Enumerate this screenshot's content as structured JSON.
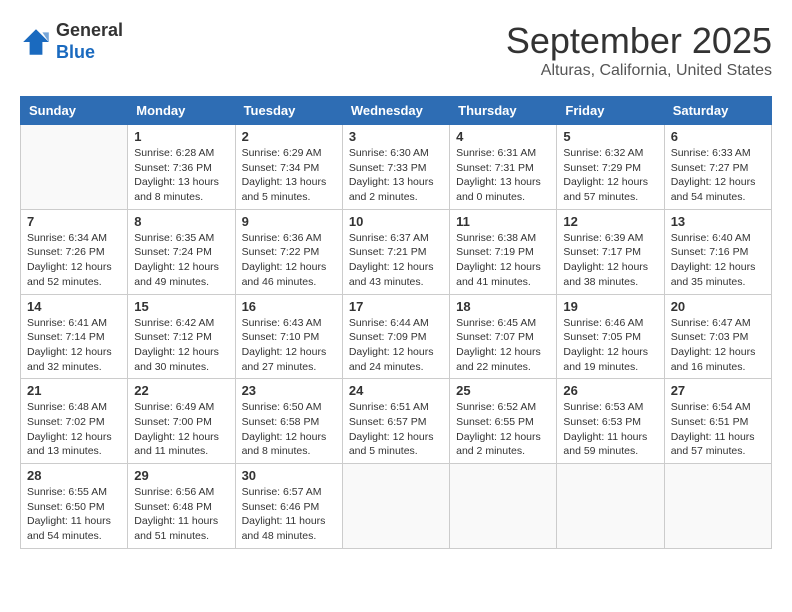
{
  "header": {
    "logo_line1": "General",
    "logo_line2": "Blue",
    "month": "September 2025",
    "location": "Alturas, California, United States"
  },
  "weekdays": [
    "Sunday",
    "Monday",
    "Tuesday",
    "Wednesday",
    "Thursday",
    "Friday",
    "Saturday"
  ],
  "weeks": [
    [
      {
        "day": "",
        "info": ""
      },
      {
        "day": "1",
        "info": "Sunrise: 6:28 AM\nSunset: 7:36 PM\nDaylight: 13 hours\nand 8 minutes."
      },
      {
        "day": "2",
        "info": "Sunrise: 6:29 AM\nSunset: 7:34 PM\nDaylight: 13 hours\nand 5 minutes."
      },
      {
        "day": "3",
        "info": "Sunrise: 6:30 AM\nSunset: 7:33 PM\nDaylight: 13 hours\nand 2 minutes."
      },
      {
        "day": "4",
        "info": "Sunrise: 6:31 AM\nSunset: 7:31 PM\nDaylight: 13 hours\nand 0 minutes."
      },
      {
        "day": "5",
        "info": "Sunrise: 6:32 AM\nSunset: 7:29 PM\nDaylight: 12 hours\nand 57 minutes."
      },
      {
        "day": "6",
        "info": "Sunrise: 6:33 AM\nSunset: 7:27 PM\nDaylight: 12 hours\nand 54 minutes."
      }
    ],
    [
      {
        "day": "7",
        "info": "Sunrise: 6:34 AM\nSunset: 7:26 PM\nDaylight: 12 hours\nand 52 minutes."
      },
      {
        "day": "8",
        "info": "Sunrise: 6:35 AM\nSunset: 7:24 PM\nDaylight: 12 hours\nand 49 minutes."
      },
      {
        "day": "9",
        "info": "Sunrise: 6:36 AM\nSunset: 7:22 PM\nDaylight: 12 hours\nand 46 minutes."
      },
      {
        "day": "10",
        "info": "Sunrise: 6:37 AM\nSunset: 7:21 PM\nDaylight: 12 hours\nand 43 minutes."
      },
      {
        "day": "11",
        "info": "Sunrise: 6:38 AM\nSunset: 7:19 PM\nDaylight: 12 hours\nand 41 minutes."
      },
      {
        "day": "12",
        "info": "Sunrise: 6:39 AM\nSunset: 7:17 PM\nDaylight: 12 hours\nand 38 minutes."
      },
      {
        "day": "13",
        "info": "Sunrise: 6:40 AM\nSunset: 7:16 PM\nDaylight: 12 hours\nand 35 minutes."
      }
    ],
    [
      {
        "day": "14",
        "info": "Sunrise: 6:41 AM\nSunset: 7:14 PM\nDaylight: 12 hours\nand 32 minutes."
      },
      {
        "day": "15",
        "info": "Sunrise: 6:42 AM\nSunset: 7:12 PM\nDaylight: 12 hours\nand 30 minutes."
      },
      {
        "day": "16",
        "info": "Sunrise: 6:43 AM\nSunset: 7:10 PM\nDaylight: 12 hours\nand 27 minutes."
      },
      {
        "day": "17",
        "info": "Sunrise: 6:44 AM\nSunset: 7:09 PM\nDaylight: 12 hours\nand 24 minutes."
      },
      {
        "day": "18",
        "info": "Sunrise: 6:45 AM\nSunset: 7:07 PM\nDaylight: 12 hours\nand 22 minutes."
      },
      {
        "day": "19",
        "info": "Sunrise: 6:46 AM\nSunset: 7:05 PM\nDaylight: 12 hours\nand 19 minutes."
      },
      {
        "day": "20",
        "info": "Sunrise: 6:47 AM\nSunset: 7:03 PM\nDaylight: 12 hours\nand 16 minutes."
      }
    ],
    [
      {
        "day": "21",
        "info": "Sunrise: 6:48 AM\nSunset: 7:02 PM\nDaylight: 12 hours\nand 13 minutes."
      },
      {
        "day": "22",
        "info": "Sunrise: 6:49 AM\nSunset: 7:00 PM\nDaylight: 12 hours\nand 11 minutes."
      },
      {
        "day": "23",
        "info": "Sunrise: 6:50 AM\nSunset: 6:58 PM\nDaylight: 12 hours\nand 8 minutes."
      },
      {
        "day": "24",
        "info": "Sunrise: 6:51 AM\nSunset: 6:57 PM\nDaylight: 12 hours\nand 5 minutes."
      },
      {
        "day": "25",
        "info": "Sunrise: 6:52 AM\nSunset: 6:55 PM\nDaylight: 12 hours\nand 2 minutes."
      },
      {
        "day": "26",
        "info": "Sunrise: 6:53 AM\nSunset: 6:53 PM\nDaylight: 11 hours\nand 59 minutes."
      },
      {
        "day": "27",
        "info": "Sunrise: 6:54 AM\nSunset: 6:51 PM\nDaylight: 11 hours\nand 57 minutes."
      }
    ],
    [
      {
        "day": "28",
        "info": "Sunrise: 6:55 AM\nSunset: 6:50 PM\nDaylight: 11 hours\nand 54 minutes."
      },
      {
        "day": "29",
        "info": "Sunrise: 6:56 AM\nSunset: 6:48 PM\nDaylight: 11 hours\nand 51 minutes."
      },
      {
        "day": "30",
        "info": "Sunrise: 6:57 AM\nSunset: 6:46 PM\nDaylight: 11 hours\nand 48 minutes."
      },
      {
        "day": "",
        "info": ""
      },
      {
        "day": "",
        "info": ""
      },
      {
        "day": "",
        "info": ""
      },
      {
        "day": "",
        "info": ""
      }
    ]
  ]
}
